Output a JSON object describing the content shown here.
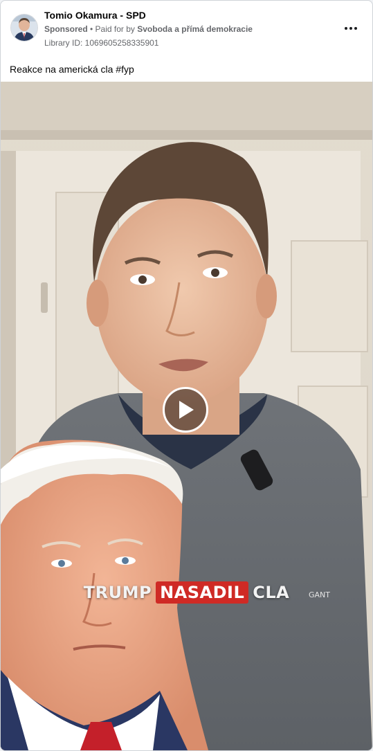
{
  "post": {
    "page_name": "Tomio Okamura - SPD",
    "sponsored_label": "Sponsored",
    "separator": " • ",
    "paid_for_prefix": "Paid for by ",
    "paid_for_by": "Svoboda a přímá demokracie",
    "library_id": "Library ID: 1069605258335901",
    "more_icon": "more-horizontal-icon",
    "caption": "Reakce na americká cla #fyp"
  },
  "video": {
    "overlay_word_1": "TRUMP",
    "overlay_word_2": "NASADIL",
    "overlay_word_3": "CLA",
    "highlight_color": "#cf2a25",
    "play_icon": "play-icon"
  }
}
